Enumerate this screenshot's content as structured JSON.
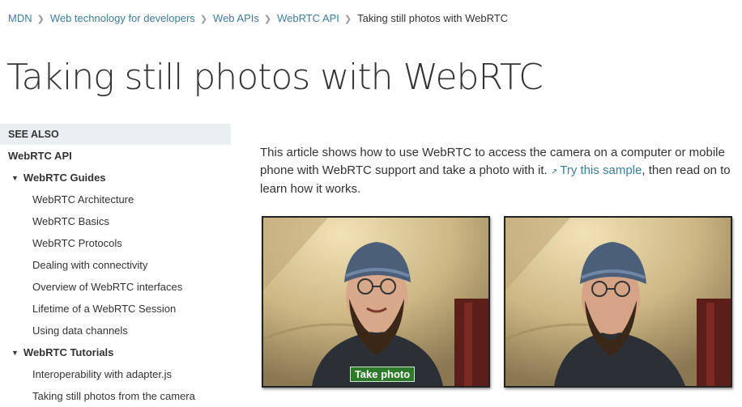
{
  "breadcrumb": {
    "items": [
      "MDN",
      "Web technology for developers",
      "Web APIs",
      "WebRTC API"
    ],
    "current": "Taking still photos with WebRTC"
  },
  "page_title": "Taking still photos with WebRTC",
  "sidebar": {
    "see_also": "SEE ALSO",
    "api": "WebRTC API",
    "guides_label": "WebRTC Guides",
    "guides": [
      "WebRTC Architecture",
      "WebRTC Basics",
      "WebRTC Protocols",
      "Dealing with connectivity",
      "Overview of WebRTC interfaces",
      "Lifetime of a WebRTC Session",
      "Using data channels"
    ],
    "tutorials_label": "WebRTC Tutorials",
    "tutorials": [
      "Interoperability with adapter.js",
      "Taking still photos from the camera"
    ]
  },
  "article": {
    "intro_before": "This article shows how to use WebRTC to access the camera on a computer or mobile phone with WebRTC support and take a photo with it.",
    "link_text": "Try this sample",
    "intro_after": ", then read on to learn how it works."
  },
  "demo": {
    "take_photo_label": "Take photo"
  },
  "colors": {
    "link": "#3d7e9a",
    "sidebar_header_bg": "#eaeff2",
    "take_photo_bg": "#2d7a2a"
  },
  "icons": {
    "breadcrumb_separator": "chevron-right-icon",
    "group_toggle": "triangle-down-icon",
    "external_link": "external-link-icon"
  }
}
